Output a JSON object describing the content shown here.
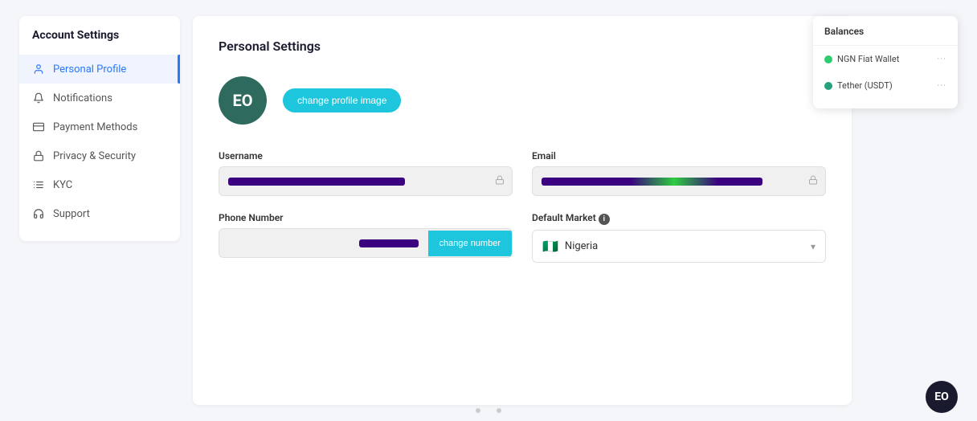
{
  "page": {
    "title": "Account Settings"
  },
  "sidebar": {
    "items": [
      {
        "id": "personal-profile",
        "label": "Personal Profile",
        "icon": "user",
        "active": true
      },
      {
        "id": "notifications",
        "label": "Notifications",
        "icon": "bell",
        "active": false
      },
      {
        "id": "payment-methods",
        "label": "Payment Methods",
        "icon": "credit-card",
        "active": false
      },
      {
        "id": "privacy-security",
        "label": "Privacy & Security",
        "icon": "lock",
        "active": false
      },
      {
        "id": "kyc",
        "label": "KYC",
        "icon": "list",
        "active": false
      },
      {
        "id": "support",
        "label": "Support",
        "icon": "headset",
        "active": false
      }
    ]
  },
  "main": {
    "section_title": "Personal Settings",
    "avatar_initials": "EO",
    "change_photo_label": "change profile image",
    "fields": {
      "username_label": "Username",
      "email_label": "Email",
      "phone_label": "Phone Number",
      "market_label": "Default Market",
      "market_info_icon": "i",
      "change_number_label": "change number",
      "market_value": "Nigeria",
      "market_flag": "🇳🇬"
    }
  },
  "balances": {
    "title": "Balances",
    "items": [
      {
        "name": "NGN Fiat Wallet",
        "type": "ngn",
        "dots": "···"
      },
      {
        "name": "Tether (USDT)",
        "type": "usdt",
        "dots": "···"
      }
    ]
  },
  "icons": {
    "user": "👤",
    "bell": "🔔",
    "creditcard": "💳",
    "lock": "🔒",
    "list": "📋",
    "headset": "🎧"
  }
}
